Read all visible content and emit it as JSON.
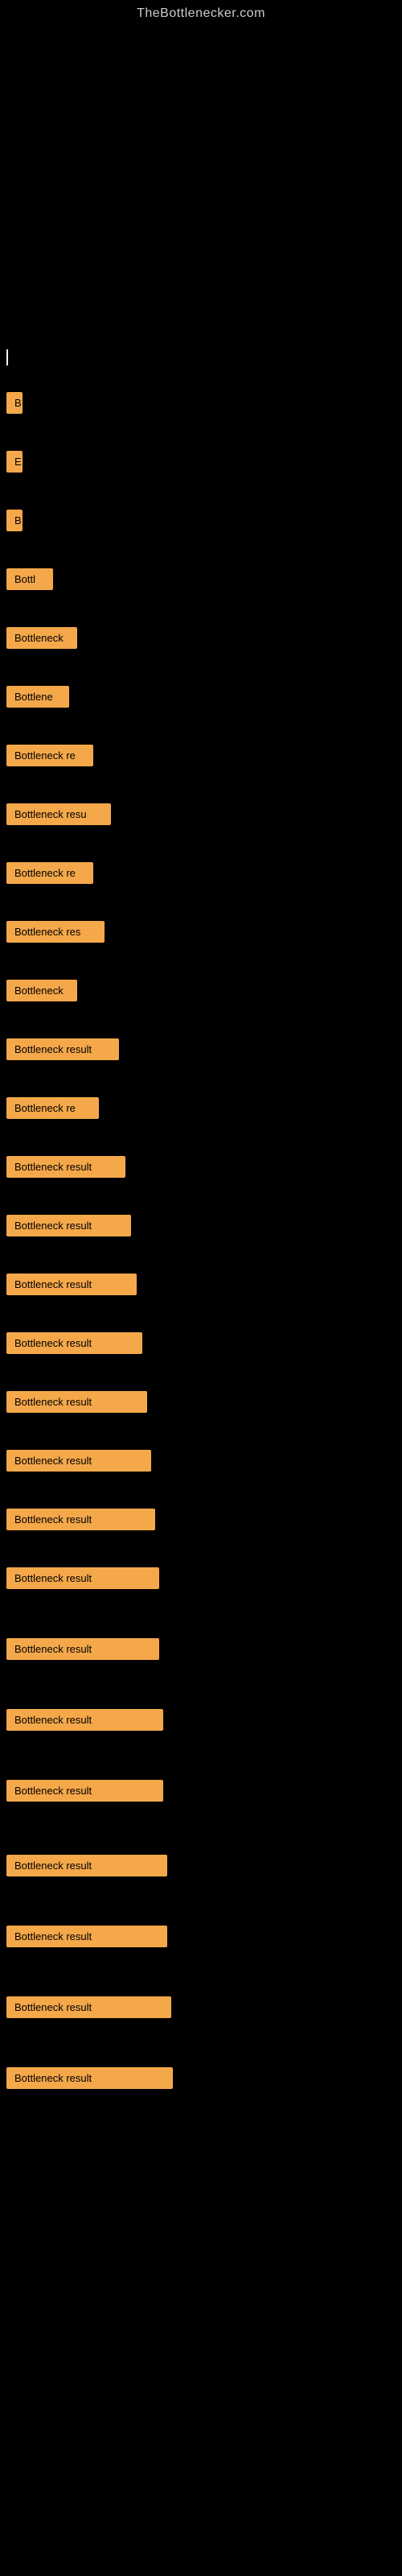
{
  "site": {
    "title": "TheBottlenecker.com"
  },
  "results": [
    {
      "id": "r0",
      "label": "|",
      "class": "result-tiny"
    },
    {
      "id": "r1",
      "label": "B",
      "class": "result-tiny"
    },
    {
      "id": "r2",
      "label": "E",
      "class": "result-tiny"
    },
    {
      "id": "r3",
      "label": "B",
      "class": "result-tiny"
    },
    {
      "id": "r4",
      "label": "Bottl",
      "class": "result-bottl"
    },
    {
      "id": "r5",
      "label": "Bottleneck",
      "class": "result-bottleneck"
    },
    {
      "id": "r6",
      "label": "Bottlene",
      "class": "result-bottlene"
    },
    {
      "id": "r7",
      "label": "Bottleneck re",
      "class": "result-bottleneck-r"
    },
    {
      "id": "r8",
      "label": "Bottleneck resu",
      "class": "result-bottleneck-resu"
    },
    {
      "id": "r9",
      "label": "Bottleneck re",
      "class": "result-bottleneck-r2"
    },
    {
      "id": "r10",
      "label": "Bottleneck res",
      "class": "result-bottleneck-res"
    },
    {
      "id": "r11",
      "label": "Bottleneck",
      "class": "result-bottleneck2"
    },
    {
      "id": "r12",
      "label": "Bottleneck result",
      "class": "result-bottleneck-result"
    },
    {
      "id": "r13",
      "label": "Bottleneck re",
      "class": "result-bottleneck-re"
    },
    {
      "id": "r14",
      "label": "Bottleneck result",
      "class": "result-full-1"
    },
    {
      "id": "r15",
      "label": "Bottleneck result",
      "class": "result-full-2"
    },
    {
      "id": "r16",
      "label": "Bottleneck result",
      "class": "result-full-3"
    },
    {
      "id": "r17",
      "label": "Bottleneck result",
      "class": "result-full-4"
    },
    {
      "id": "r18",
      "label": "Bottleneck result",
      "class": "result-full-5"
    },
    {
      "id": "r19",
      "label": "Bottleneck result",
      "class": "result-full-6"
    },
    {
      "id": "r20",
      "label": "Bottleneck result",
      "class": "result-full-7"
    },
    {
      "id": "r21",
      "label": "Bottleneck result",
      "class": "result-full-8"
    },
    {
      "id": "r22",
      "label": "Bottleneck result",
      "class": "result-full-9"
    },
    {
      "id": "r23",
      "label": "Bottleneck result",
      "class": "result-full-10"
    },
    {
      "id": "r24",
      "label": "Bottleneck result",
      "class": "result-full-11"
    },
    {
      "id": "r25",
      "label": "Bottleneck result",
      "class": "result-full-12"
    },
    {
      "id": "r26",
      "label": "Bottleneck result",
      "class": "result-full-13"
    },
    {
      "id": "r27",
      "label": "Bottleneck result",
      "class": "result-full-14"
    }
  ],
  "gaps": {
    "after_title": 400,
    "between_items": 55
  }
}
